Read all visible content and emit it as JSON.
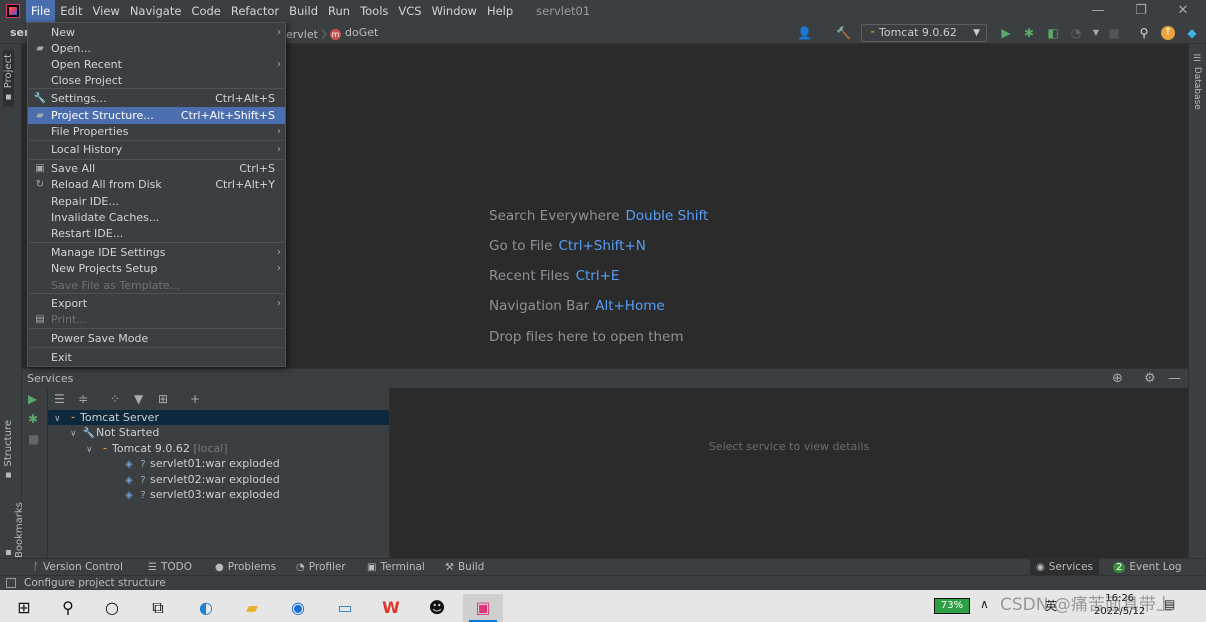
{
  "menubar": {
    "items": [
      "File",
      "Edit",
      "View",
      "Navigate",
      "Code",
      "Refactor",
      "Build",
      "Run",
      "Tools",
      "VCS",
      "Window",
      "Help"
    ],
    "project_name": "servlet01",
    "window_controls": [
      "—",
      "❐",
      "✕"
    ]
  },
  "navbar": {
    "project_crumb": "ser",
    "crumb_prefix": "ervlet",
    "crumb_method": "doGet",
    "run_config": "Tomcat 9.0.62"
  },
  "left_stripe": {
    "project": "Project",
    "structure": "Structure",
    "bookmarks": "Bookmarks"
  },
  "right_stripe": {
    "database": "Database"
  },
  "file_menu": {
    "items": [
      {
        "label": "New",
        "shortcut": "",
        "submenu": true,
        "icon": "",
        "disabled": false
      },
      {
        "label": "Open...",
        "shortcut": "",
        "submenu": false,
        "icon": "folder-icon",
        "disabled": false
      },
      {
        "label": "Open Recent",
        "shortcut": "",
        "submenu": true,
        "icon": "",
        "disabled": false
      },
      {
        "label": "Close Project",
        "shortcut": "",
        "submenu": false,
        "icon": "",
        "disabled": false
      },
      {
        "label": "Settings...",
        "shortcut": "Ctrl+Alt+S",
        "submenu": false,
        "icon": "wrench-icon",
        "disabled": false
      },
      {
        "label": "Project Structure...",
        "shortcut": "Ctrl+Alt+Shift+S",
        "submenu": false,
        "icon": "folder-structure-icon",
        "disabled": false
      },
      {
        "label": "File Properties",
        "shortcut": "",
        "submenu": true,
        "icon": "",
        "disabled": false
      },
      {
        "label": "Local History",
        "shortcut": "",
        "submenu": true,
        "icon": "",
        "disabled": false
      },
      {
        "label": "Save All",
        "shortcut": "Ctrl+S",
        "submenu": false,
        "icon": "save-icon",
        "disabled": false
      },
      {
        "label": "Reload All from Disk",
        "shortcut": "Ctrl+Alt+Y",
        "submenu": false,
        "icon": "reload-icon",
        "disabled": false
      },
      {
        "label": "Repair IDE...",
        "shortcut": "",
        "submenu": false,
        "icon": "",
        "disabled": false
      },
      {
        "label": "Invalidate Caches...",
        "shortcut": "",
        "submenu": false,
        "icon": "",
        "disabled": false
      },
      {
        "label": "Restart IDE...",
        "shortcut": "",
        "submenu": false,
        "icon": "",
        "disabled": false
      },
      {
        "label": "Manage IDE Settings",
        "shortcut": "",
        "submenu": true,
        "icon": "",
        "disabled": false
      },
      {
        "label": "New Projects Setup",
        "shortcut": "",
        "submenu": true,
        "icon": "",
        "disabled": false
      },
      {
        "label": "Save File as Template...",
        "shortcut": "",
        "submenu": false,
        "icon": "",
        "disabled": true
      },
      {
        "label": "Export",
        "shortcut": "",
        "submenu": true,
        "icon": "",
        "disabled": false
      },
      {
        "label": "Print...",
        "shortcut": "",
        "submenu": false,
        "icon": "printer-icon",
        "disabled": true
      },
      {
        "label": "Power Save Mode",
        "shortcut": "",
        "submenu": false,
        "icon": "",
        "disabled": false
      },
      {
        "label": "Exit",
        "shortcut": "",
        "submenu": false,
        "icon": "",
        "disabled": false
      }
    ]
  },
  "editor_hints": [
    {
      "text": "Search Everywhere",
      "key": "Double Shift"
    },
    {
      "text": "Go to File",
      "key": "Ctrl+Shift+N"
    },
    {
      "text": "Recent Files",
      "key": "Ctrl+E"
    },
    {
      "text": "Navigation Bar",
      "key": "Alt+Home"
    },
    {
      "text": "Drop files here to open them",
      "key": ""
    }
  ],
  "services": {
    "title": "Services",
    "tree": [
      {
        "label": "Tomcat Server",
        "suffix": "",
        "level": 0
      },
      {
        "label": "Not Started",
        "suffix": "",
        "level": 1
      },
      {
        "label": "Tomcat 9.0.62",
        "suffix": "[local]",
        "level": 2
      },
      {
        "label": "servlet01:war exploded",
        "suffix": "",
        "level": 3
      },
      {
        "label": "servlet02:war exploded",
        "suffix": "",
        "level": 3
      },
      {
        "label": "servlet03:war exploded",
        "suffix": "",
        "level": 3
      }
    ],
    "detail_placeholder": "Select service to view details"
  },
  "bottom_tabs": {
    "version_control": "Version Control",
    "todo": "TODO",
    "problems": "Problems",
    "profiler": "Profiler",
    "terminal": "Terminal",
    "build": "Build",
    "services": "Services",
    "event_log": "Event Log",
    "event_log_badge": "2"
  },
  "status": {
    "text": "Configure project structure"
  },
  "taskbar": {
    "battery": "73%",
    "ime": "英",
    "clock_time": "16:26",
    "clock_date": "2022/5/12",
    "watermark": "CSDN @痛苦面具带上"
  },
  "colors": {
    "accent": "#4b6eaf",
    "link": "#589df6",
    "background": "#2b2b2b",
    "panel": "#3c3f41"
  }
}
